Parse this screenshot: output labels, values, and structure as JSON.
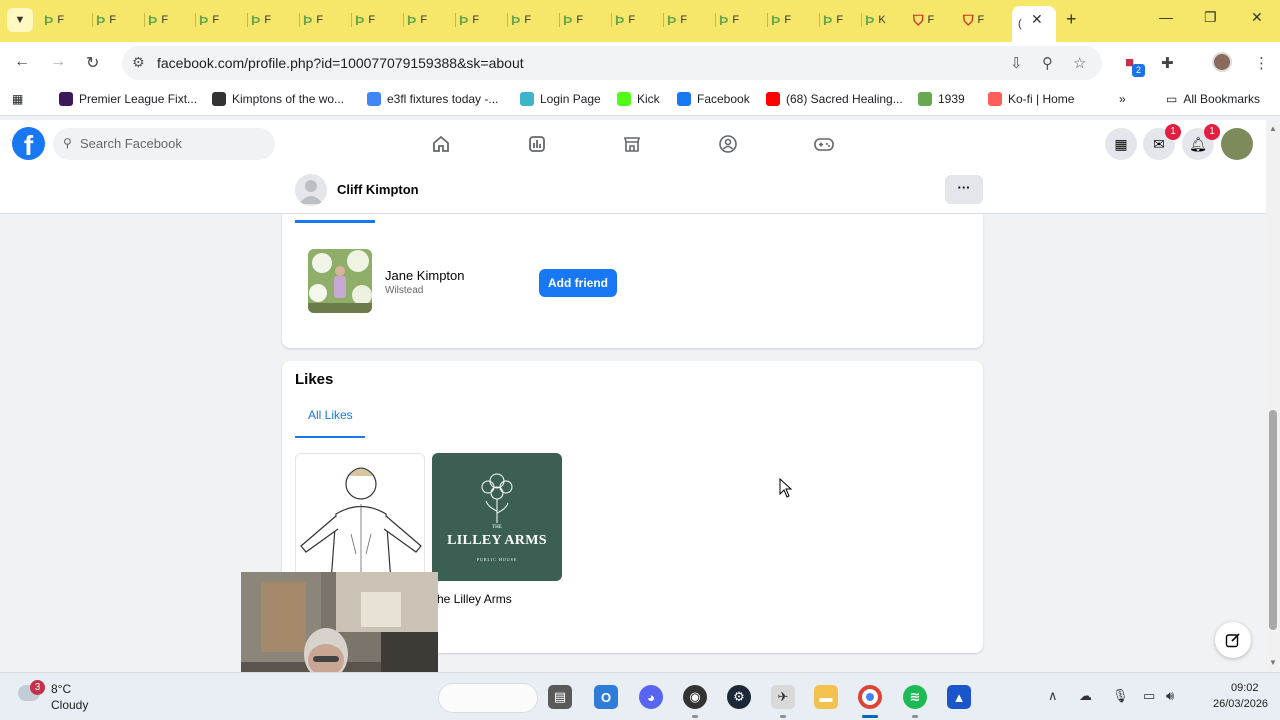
{
  "browser": {
    "tabs": [
      {
        "fav": "Þ",
        "text": "F"
      },
      {
        "fav": "Þ",
        "text": "F"
      },
      {
        "fav": "Þ",
        "text": "F"
      },
      {
        "fav": "Þ",
        "text": "F"
      },
      {
        "fav": "Þ",
        "text": "F"
      },
      {
        "fav": "Þ",
        "text": "F"
      },
      {
        "fav": "Þ",
        "text": "F"
      },
      {
        "fav": "Þ",
        "text": "F"
      },
      {
        "fav": "Þ",
        "text": "F"
      },
      {
        "fav": "Þ",
        "text": "F"
      },
      {
        "fav": "Þ",
        "text": "F"
      },
      {
        "fav": "Þ",
        "text": "F"
      },
      {
        "fav": "Þ",
        "text": "F"
      },
      {
        "fav": "Þ",
        "text": "F"
      },
      {
        "fav": "Þ",
        "text": "F"
      },
      {
        "fav": "Þ",
        "text": "F"
      },
      {
        "fav": "Þ",
        "text": "K"
      }
    ],
    "fs_tabs": [
      {
        "text": "F"
      },
      {
        "text": "F"
      }
    ],
    "active_tab_text": "(",
    "url": "facebook.com/profile.php?id=100077079159388&sk=about",
    "extension_badge": "2",
    "bookmarks": [
      {
        "label": "Premier League Fixt...",
        "icon": "premier-league-icon",
        "color": "#3d195b"
      },
      {
        "label": "Kimptons of the wo...",
        "icon": "globe-icon",
        "color": "#333333"
      },
      {
        "label": "e3fl fixtures today -...",
        "icon": "google-icon",
        "color": "#4285f4"
      },
      {
        "label": "Login Page",
        "icon": "login-icon",
        "color": "#3cb4c9"
      },
      {
        "label": "Kick",
        "icon": "kick-icon",
        "color": "#53fc18"
      },
      {
        "label": "Facebook",
        "icon": "facebook-icon",
        "color": "#1877f2"
      },
      {
        "label": "(68) Sacred Healing...",
        "icon": "youtube-icon",
        "color": "#ff0000"
      },
      {
        "label": "1939",
        "icon": "bookmark-favicon-icon",
        "color": "#6aa84f"
      },
      {
        "label": "Ko-fi | Home",
        "icon": "kofi-icon",
        "color": "#ff5e5b"
      }
    ],
    "all_bookmarks": "All Bookmarks"
  },
  "facebook": {
    "search_placeholder": "Search Facebook",
    "messenger_badge": "1",
    "notifications_badge": "1",
    "profile_name": "Cliff Kimpton",
    "more_label": "···",
    "friend": {
      "name": "Jane Kimpton",
      "location": "Wilstead",
      "add_friend_label": "Add friend"
    },
    "likes": {
      "title": "Likes",
      "tab_label": "All Likes",
      "items": [
        {
          "label": "The Lilley Arms",
          "logo_the": "THE",
          "logo_name": "LILLEY ARMS",
          "logo_sub": "PUBLIC HOUSE"
        }
      ],
      "visible_label": "he Lilley Arms"
    }
  },
  "taskbar": {
    "weather_badge": "3",
    "temperature": "8°C",
    "condition": "Cloudy",
    "time": "09:02",
    "date": "26/03/2026"
  }
}
